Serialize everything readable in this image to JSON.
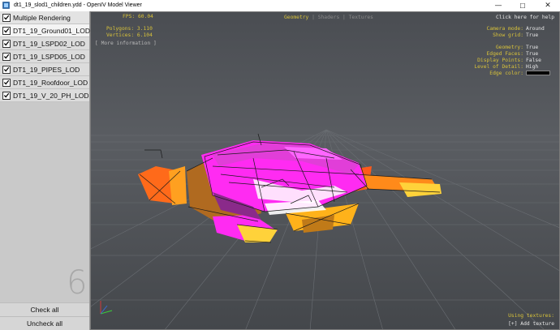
{
  "window": {
    "title": "dt1_19_slod1_children.ydd - OpenIV Model Viewer",
    "controls": {
      "minimize": "—",
      "maximize": "☐",
      "close": "✕"
    }
  },
  "sidebar": {
    "header": {
      "label": "Multiple Rendering",
      "checked": true
    },
    "layers": [
      {
        "label": "DT1_19_Ground01_LOD",
        "checked": true,
        "selected": true
      },
      {
        "label": "DT1_19_LSPD02_LOD",
        "checked": true,
        "selected": false
      },
      {
        "label": "DT1_19_LSPD05_LOD",
        "checked": true,
        "selected": false
      },
      {
        "label": "DT1_19_PIPES_LOD",
        "checked": true,
        "selected": false
      },
      {
        "label": "DT1_19_Roofdoor_LOD",
        "checked": true,
        "selected": false
      },
      {
        "label": "DT1_19_V_20_PH_LOD",
        "checked": true,
        "selected": false
      }
    ],
    "count": "6",
    "check_all": "Check all",
    "uncheck_all": "Uncheck all"
  },
  "viewport": {
    "fps": "FPS: 60.04",
    "polygons": "Polygons: 3.110",
    "vertices": "Vertices: 6.104",
    "more_info": "[ More information ]",
    "tabs": {
      "active": "Geometry",
      "sep": " | ",
      "t2": "Shaders",
      "t3": "Textures"
    },
    "help": "Click here for help",
    "info": {
      "camera_mode_k": "Camera mode:",
      "camera_mode_v": "Around",
      "show_grid_k": "Show grid:",
      "show_grid_v": "True",
      "geometry_k": "Geometry:",
      "geometry_v": "True",
      "edged_faces_k": "Edged Faces:",
      "edged_faces_v": "True",
      "display_points_k": "Display Points:",
      "display_points_v": "False",
      "lod_k": "Level of Detail:",
      "lod_v": "High",
      "edge_color_k": "Edge color:"
    },
    "using_textures": "Using textures:",
    "add_texture": "[+] Add texture"
  },
  "colors": {
    "hud_yellow": "#d8c23a",
    "magenta": "#ff2bf2",
    "edge_color": "#000000"
  }
}
